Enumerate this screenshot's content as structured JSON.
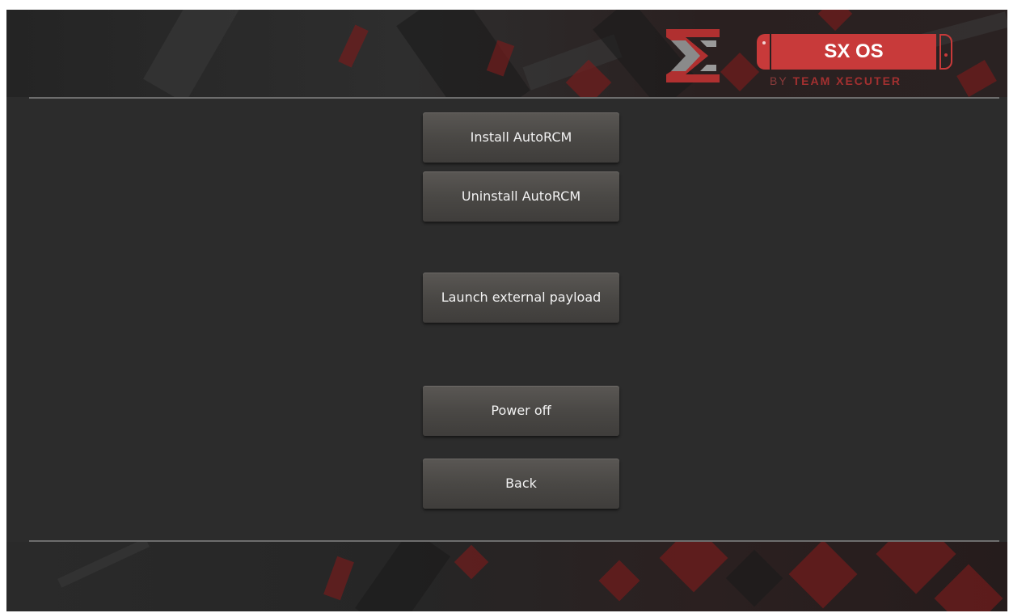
{
  "brand": {
    "product_name": "SX OS",
    "byline_prefix": "BY",
    "byline_team": "TEAM XECUTER",
    "accent_color": "#c83a3a",
    "logo_icon": "sx-logo-icon"
  },
  "menu": {
    "buttons": [
      {
        "label": "Install AutoRCM"
      },
      {
        "label": "Uninstall AutoRCM"
      },
      {
        "label": "Launch external payload"
      },
      {
        "label": "Power off"
      },
      {
        "label": "Back"
      }
    ]
  },
  "colors": {
    "background": "#2c2c2c",
    "button": "#4a4845",
    "divider": "#6d6d6d"
  }
}
